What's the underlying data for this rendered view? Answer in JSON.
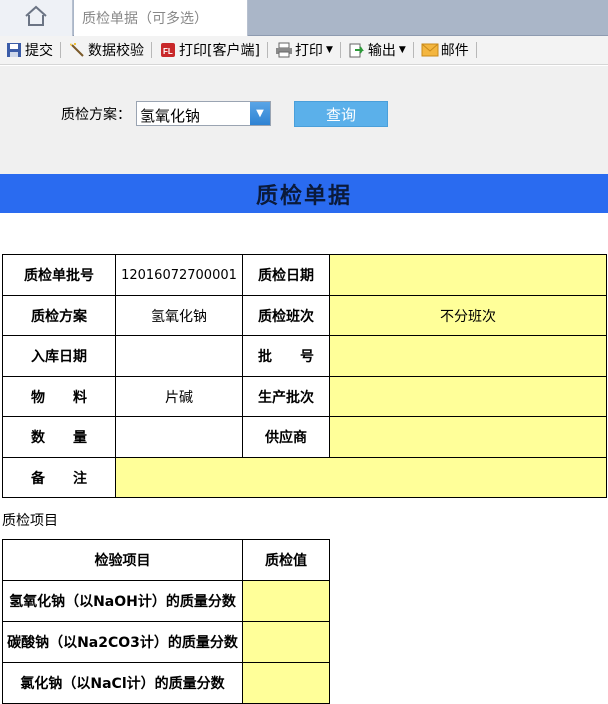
{
  "tabs": {
    "home_icon": "home-icon",
    "active_tab_label": "质检单据（可多选）"
  },
  "toolbar": {
    "items": [
      {
        "label": "提交",
        "icon": "save-icon"
      },
      {
        "label": "数据校验",
        "icon": "wand-icon"
      },
      {
        "label": "打印[客户端]",
        "icon": "print-client-icon"
      },
      {
        "label": "打印",
        "icon": "printer-icon"
      },
      {
        "label": "输出",
        "icon": "export-icon"
      },
      {
        "label": "邮件",
        "icon": "mail-icon"
      }
    ]
  },
  "filter": {
    "label": "质检方案：",
    "scheme_value": "氢氧化钠",
    "query_label": "查询"
  },
  "banner": {
    "title": "质检单据"
  },
  "header_form": {
    "batch_no_label": "质检单批号",
    "batch_no_value": "12016072700001",
    "date_label": "质检日期",
    "date_value": "",
    "scheme_label": "质检方案",
    "scheme_value": "氢氧化钠",
    "shift_label": "质检班次",
    "shift_value": "不分班次",
    "storage_date_label": "入库日期",
    "storage_date_value": "",
    "lot_label": "批　　号",
    "lot_value": "",
    "material_label": "物　　料",
    "material_value": "片碱",
    "prod_batch_label": "生产批次",
    "prod_batch_value": "",
    "qty_label": "数　　量",
    "qty_value": "",
    "supplier_label": "供应商",
    "supplier_value": "",
    "remark_label": "备　　注",
    "remark_value": ""
  },
  "items_section": {
    "title": "质检项目",
    "col_item": "检验项目",
    "col_value": "质检值",
    "rows": [
      {
        "name": "氢氧化钠（以NaOH计）的质量分数",
        "value": ""
      },
      {
        "name": "碳酸钠（以Na2CO3计）的质量分数",
        "value": ""
      },
      {
        "name": "氯化钠（以NaCl计）的质量分数",
        "value": ""
      }
    ]
  },
  "colors": {
    "banner": "#2a6bf0",
    "input_fill": "#ffff99",
    "query_button": "#5bb0ea"
  }
}
